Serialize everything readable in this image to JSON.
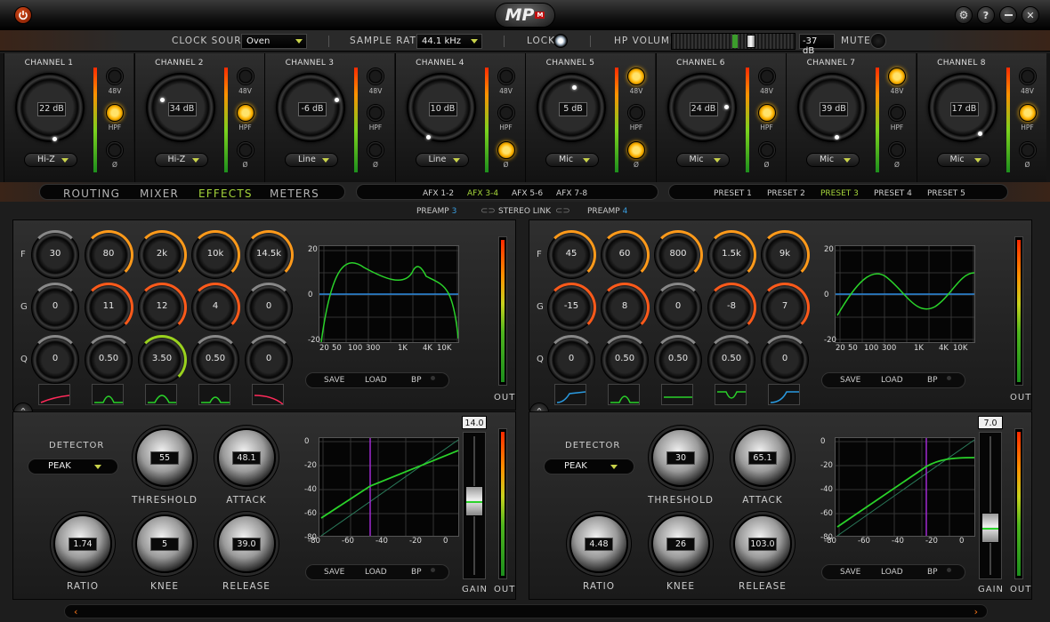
{
  "titlebar": {
    "logo_text": "MP",
    "logo_badge": "M"
  },
  "topbar": {
    "clock_source_label": "CLOCK SOURCE",
    "clock_source_value": "Oven",
    "sample_rate_label": "SAMPLE RATE",
    "sample_rate_value": "44.1 kHz",
    "lock_label": "LOCK",
    "hp_volume_label": "HP VOLUME",
    "hp_volume_value": "-37 dB",
    "mute_label": "MUTE"
  },
  "channels": [
    {
      "name": "CHANNEL 1",
      "gain": "22 dB",
      "input": "Hi-Z",
      "b48v": false,
      "hpf": true,
      "phase": false
    },
    {
      "name": "CHANNEL 2",
      "gain": "34 dB",
      "input": "Hi-Z",
      "b48v": false,
      "hpf": true,
      "phase": false
    },
    {
      "name": "CHANNEL 3",
      "gain": "-6 dB",
      "input": "Line",
      "b48v": false,
      "hpf": false,
      "phase": false
    },
    {
      "name": "CHANNEL 4",
      "gain": "10 dB",
      "input": "Line",
      "b48v": false,
      "hpf": false,
      "phase": true
    },
    {
      "name": "CHANNEL 5",
      "gain": "5 dB",
      "input": "Mic",
      "b48v": true,
      "hpf": false,
      "phase": true
    },
    {
      "name": "CHANNEL 6",
      "gain": "24 dB",
      "input": "Mic",
      "b48v": false,
      "hpf": true,
      "phase": false
    },
    {
      "name": "CHANNEL 7",
      "gain": "39 dB",
      "input": "Mic",
      "b48v": true,
      "hpf": false,
      "phase": false
    },
    {
      "name": "CHANNEL 8",
      "gain": "17 dB",
      "input": "Mic",
      "b48v": false,
      "hpf": true,
      "phase": false
    }
  ],
  "button_labels": {
    "b48v": "48V",
    "hpf": "HPF",
    "phase": "Ø"
  },
  "nav": {
    "main_tabs": [
      {
        "label": "ROUTING",
        "active": false
      },
      {
        "label": "MIXER",
        "active": false
      },
      {
        "label": "EFFECTS",
        "active": true
      },
      {
        "label": "METERS",
        "active": false
      }
    ],
    "afx_tabs": [
      {
        "label": "AFX 1-2",
        "active": false
      },
      {
        "label": "AFX 3-4",
        "active": true
      },
      {
        "label": "AFX 5-6",
        "active": false
      },
      {
        "label": "AFX 7-8",
        "active": false
      }
    ],
    "presets": [
      {
        "label": "PRESET 1",
        "active": false
      },
      {
        "label": "PRESET 2",
        "active": false
      },
      {
        "label": "PRESET 3",
        "active": true
      },
      {
        "label": "PRESET 4",
        "active": false
      },
      {
        "label": "PRESET 5",
        "active": false
      }
    ]
  },
  "link": {
    "left": "PREAMP ",
    "left_num": "3",
    "center": "STEREO LINK",
    "right": "PREAMP ",
    "right_num": "4"
  },
  "eq": {
    "row_labels": [
      "F",
      "G",
      "Q"
    ],
    "graph_y_labels": [
      "20",
      "0",
      "-20"
    ],
    "graph_x_labels": [
      "20",
      "50",
      "100",
      "300",
      "1K",
      "4K",
      "10K"
    ],
    "buttons": [
      "SAVE",
      "LOAD",
      "BP"
    ],
    "out_label": "OUT",
    "left": {
      "f": [
        "30",
        "80",
        "2k",
        "10k",
        "14.5k"
      ],
      "g": [
        "0",
        "11",
        "12",
        "4",
        "0"
      ],
      "q": [
        "0",
        "0.50",
        "3.50",
        "0.50",
        "0"
      ]
    },
    "right": {
      "f": [
        "45",
        "60",
        "800",
        "1.5k",
        "9k"
      ],
      "g": [
        "-15",
        "8",
        "0",
        "-8",
        "7"
      ],
      "q": [
        "0",
        "0.50",
        "0.50",
        "0.50",
        "0"
      ]
    }
  },
  "comp": {
    "detector_label": "DETECTOR",
    "labels": {
      "threshold": "THRESHOLD",
      "attack": "ATTACK",
      "ratio": "RATIO",
      "knee": "KNEE",
      "release": "RELEASE",
      "gain": "GAIN",
      "out": "OUT"
    },
    "graph_y_labels": [
      "0",
      "-20",
      "-40",
      "-60",
      "-80"
    ],
    "graph_x_labels": [
      "-80",
      "-60",
      "-40",
      "-20",
      "0"
    ],
    "buttons": [
      "SAVE",
      "LOAD",
      "BP"
    ],
    "left": {
      "detector": "PEAK",
      "threshold": "55",
      "attack": "48.1",
      "ratio": "1.74",
      "knee": "5",
      "release": "39.0",
      "gain": "14.0"
    },
    "right": {
      "detector": "PEAK",
      "threshold": "30",
      "attack": "65.1",
      "ratio": "4.48",
      "knee": "26",
      "release": "103.0",
      "gain": "7.0"
    }
  },
  "scroll": {
    "left": "‹",
    "right": "›"
  },
  "toggle_glyph": "⌃"
}
